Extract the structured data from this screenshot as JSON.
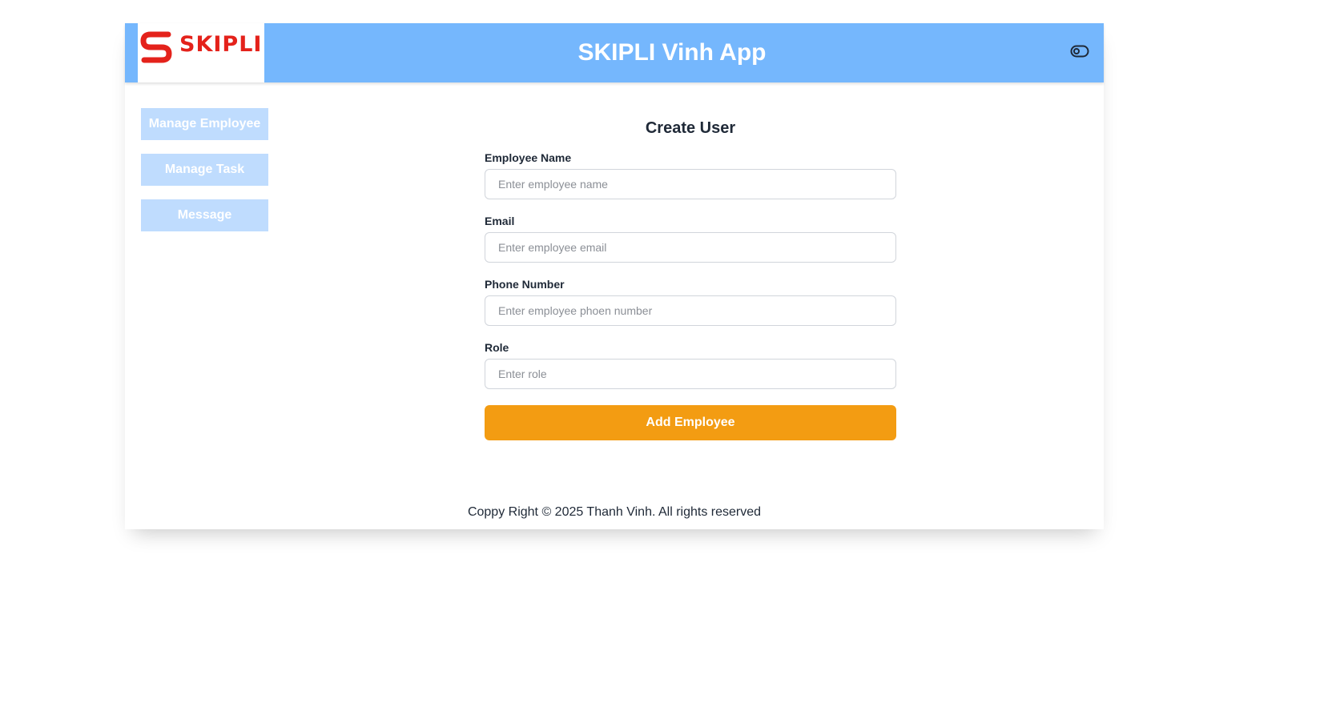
{
  "header": {
    "logo_text": "SKIPLI",
    "app_title": "SKIPLI Vinh App",
    "icons": {
      "logo": "skipli-s-logo",
      "theme_toggle": "toggle-icon"
    },
    "colors": {
      "header_bg": "#75b7fd",
      "logo_red": "#e4221b"
    }
  },
  "sidebar": {
    "items": [
      {
        "label": "Manage Employee"
      },
      {
        "label": "Manage Task"
      },
      {
        "label": "Message"
      }
    ],
    "colors": {
      "item_bg": "#bfdcfe"
    }
  },
  "form": {
    "title": "Create User",
    "fields": [
      {
        "label": "Employee Name",
        "placeholder": "Enter employee name",
        "value": ""
      },
      {
        "label": "Email",
        "placeholder": "Enter employee email",
        "value": ""
      },
      {
        "label": "Phone Number",
        "placeholder": "Enter employee phoen number",
        "value": ""
      },
      {
        "label": "Role",
        "placeholder": "Enter role",
        "value": ""
      }
    ],
    "submit_label": "Add Employee",
    "colors": {
      "submit_bg": "#f39c12"
    }
  },
  "footer": {
    "text": "Coppy Right © 2025 Thanh Vinh. All rights reserved"
  }
}
